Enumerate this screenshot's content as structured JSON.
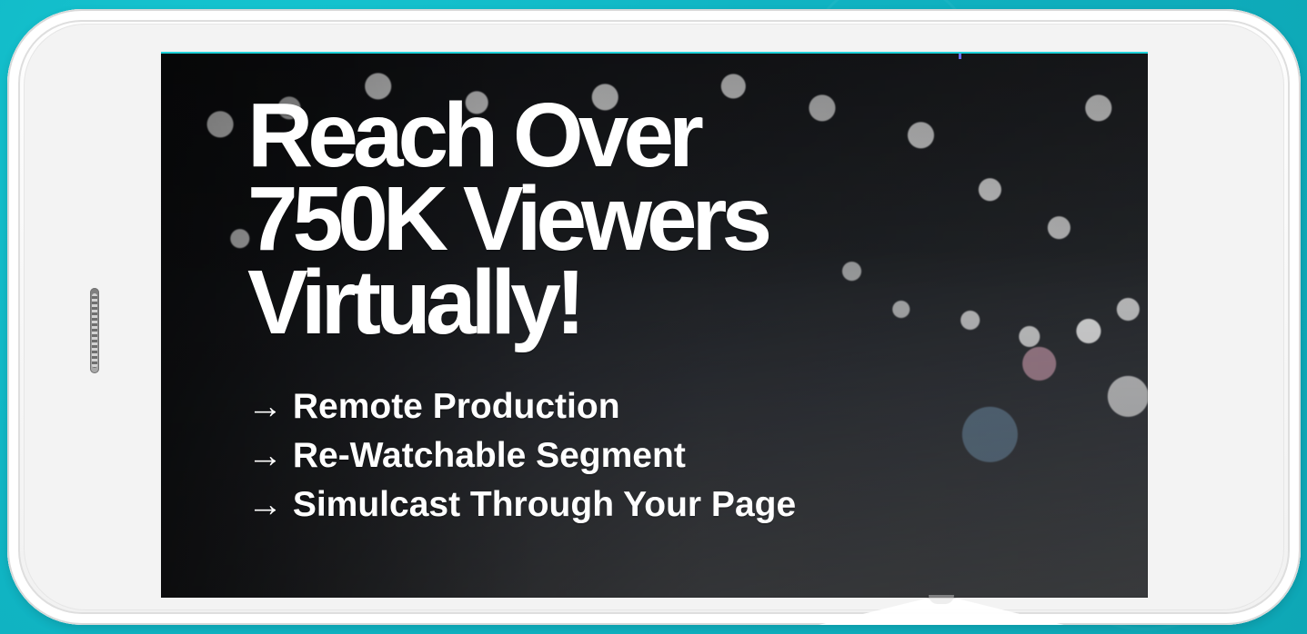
{
  "hero": {
    "headline_lines": [
      "Reach Over",
      "750K Viewers",
      "Virtually!"
    ],
    "bullets": [
      "→ Remote Production",
      "→ Re-Watchable Segment",
      "→ Simulcast Through Your Page"
    ]
  },
  "colors": {
    "background_accent": "#11b8c6",
    "phone_frame": "#f3f3f3",
    "screen_border": "#1fd2da",
    "headline_text": "#ffffff"
  },
  "icons": {
    "speaker": "speaker-grille-icon"
  }
}
